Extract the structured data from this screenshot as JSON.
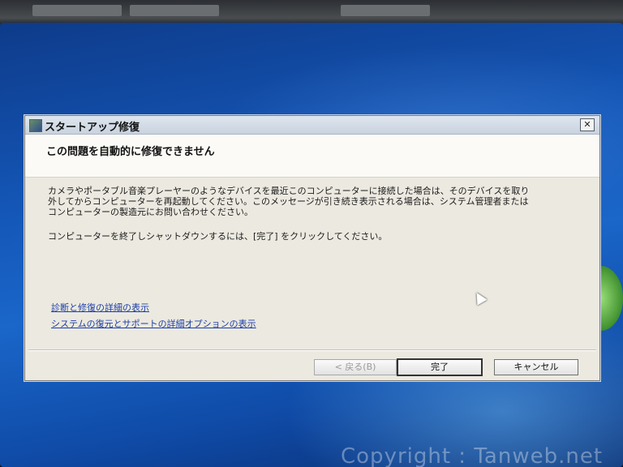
{
  "dialog": {
    "title": "スタートアップ修復",
    "close_label": "✕",
    "header": "この問題を自動的に修復できません",
    "message_lines": [
      "カメラやポータブル音楽プレーヤーのようなデバイスを最近このコンピューターに接続した場合は、そのデバイスを取り",
      "外してからコンピューターを再起動してください。このメッセージが引き続き表示される場合は、システム管理者または",
      "コンピューターの製造元にお問い合わせください。"
    ],
    "instruction": "コンピューターを終了しシャットダウンするには、[完了] をクリックしてください。",
    "links": [
      "診断と修復の詳細の表示",
      "システムの復元とサポートの詳細オプションの表示"
    ],
    "buttons": {
      "back": "< 戻る(B)",
      "finish": "完了",
      "cancel": "キャンセル"
    }
  },
  "watermark": "Copyright : Tanweb.net",
  "colors": {
    "link": "#1c3fa8",
    "dialog_bg": "#ece9e0",
    "desktop": "#1457b8"
  }
}
